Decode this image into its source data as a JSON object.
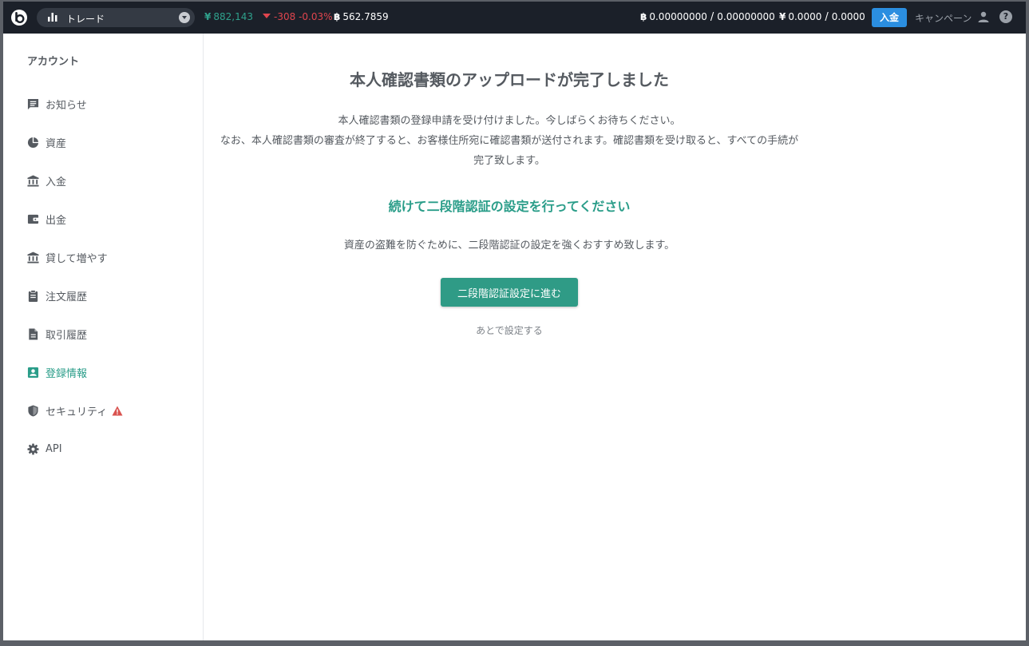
{
  "topbar": {
    "trade_label": "トレード",
    "price_symbol": "¥",
    "price_value": "882,143",
    "change_value": "-308",
    "change_percent": "-0.03%",
    "btc_symbol": "฿",
    "btc_value": "562.7859",
    "btc_balance_available": "0.00000000",
    "btc_balance_total": "0.00000000",
    "jpy_symbol": "¥",
    "jpy_balance_available": "0.0000",
    "jpy_balance_total": "0.0000",
    "separator": "/",
    "deposit_label": "入金",
    "campaign_label": "キャンペーン",
    "help_label": "?"
  },
  "sidebar": {
    "title": "アカウント",
    "items": [
      {
        "label": "お知らせ",
        "icon": "message-icon"
      },
      {
        "label": "資産",
        "icon": "pie-chart-icon"
      },
      {
        "label": "入金",
        "icon": "bank-icon"
      },
      {
        "label": "出金",
        "icon": "wallet-icon"
      },
      {
        "label": "貸して増やす",
        "icon": "bank-icon"
      },
      {
        "label": "注文履歴",
        "icon": "clipboard-icon"
      },
      {
        "label": "取引履歴",
        "icon": "document-icon"
      },
      {
        "label": "登録情報",
        "icon": "account-box-icon",
        "active": true
      },
      {
        "label": "セキュリティ",
        "icon": "shield-icon",
        "warning": true
      },
      {
        "label": "API",
        "icon": "gear-icon"
      }
    ]
  },
  "main": {
    "headline": "本人確認書類のアップロードが完了しました",
    "description_line1": "本人確認書類の登録申請を受け付けました。今しばらくお待ちください。",
    "description_line2": "なお、本人確認書類の審査が終了すると、お客様住所宛に確認書類が送付されます。確認書類を受け取ると、すべての手続が完了致します。",
    "sub_heading": "続けて二段階認証の設定を行ってください",
    "recommendation": "資産の盗難を防ぐために、二段階認証の設定を強くおすすめ致します。",
    "proceed_button": "二段階認証設定に進む",
    "later_link": "あとで設定する"
  },
  "colors": {
    "topbar_bg": "#1b2029",
    "accent_green": "#2a9d89",
    "price_green": "#2fa18c",
    "change_red": "#e0454e",
    "deposit_blue": "#2b8ee0",
    "text_gray": "#555a60",
    "warning_red": "#d9534f"
  }
}
